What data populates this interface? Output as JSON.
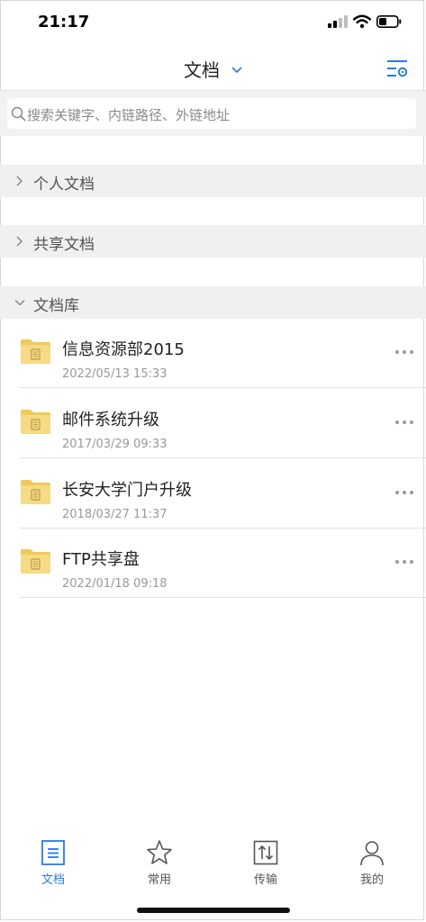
{
  "status_bar": {
    "time": "21:17"
  },
  "header": {
    "title": "文档"
  },
  "search": {
    "placeholder": "搜索关键字、内链路径、外链地址"
  },
  "sections": [
    {
      "label": "个人文档",
      "expanded": false
    },
    {
      "label": "共享文档",
      "expanded": false
    },
    {
      "label": "文档库",
      "expanded": true
    }
  ],
  "library_items": [
    {
      "name": "信息资源部2015",
      "date": "2022/05/13 15:33"
    },
    {
      "name": "邮件系统升级",
      "date": "2017/03/29 09:33"
    },
    {
      "name": "长安大学门户升级",
      "date": "2018/03/27 11:37"
    },
    {
      "name": "FTP共享盘",
      "date": "2022/01/18 09:18"
    }
  ],
  "tabs": [
    {
      "label": "文档",
      "icon": "document-list-icon",
      "active": true
    },
    {
      "label": "常用",
      "icon": "star-icon",
      "active": false
    },
    {
      "label": "传输",
      "icon": "transfer-icon",
      "active": false
    },
    {
      "label": "我的",
      "icon": "person-icon",
      "active": false
    }
  ],
  "colors": {
    "accent": "#2a7be3",
    "folder": "#f5d77a",
    "section_bg": "#f0f0f0"
  }
}
